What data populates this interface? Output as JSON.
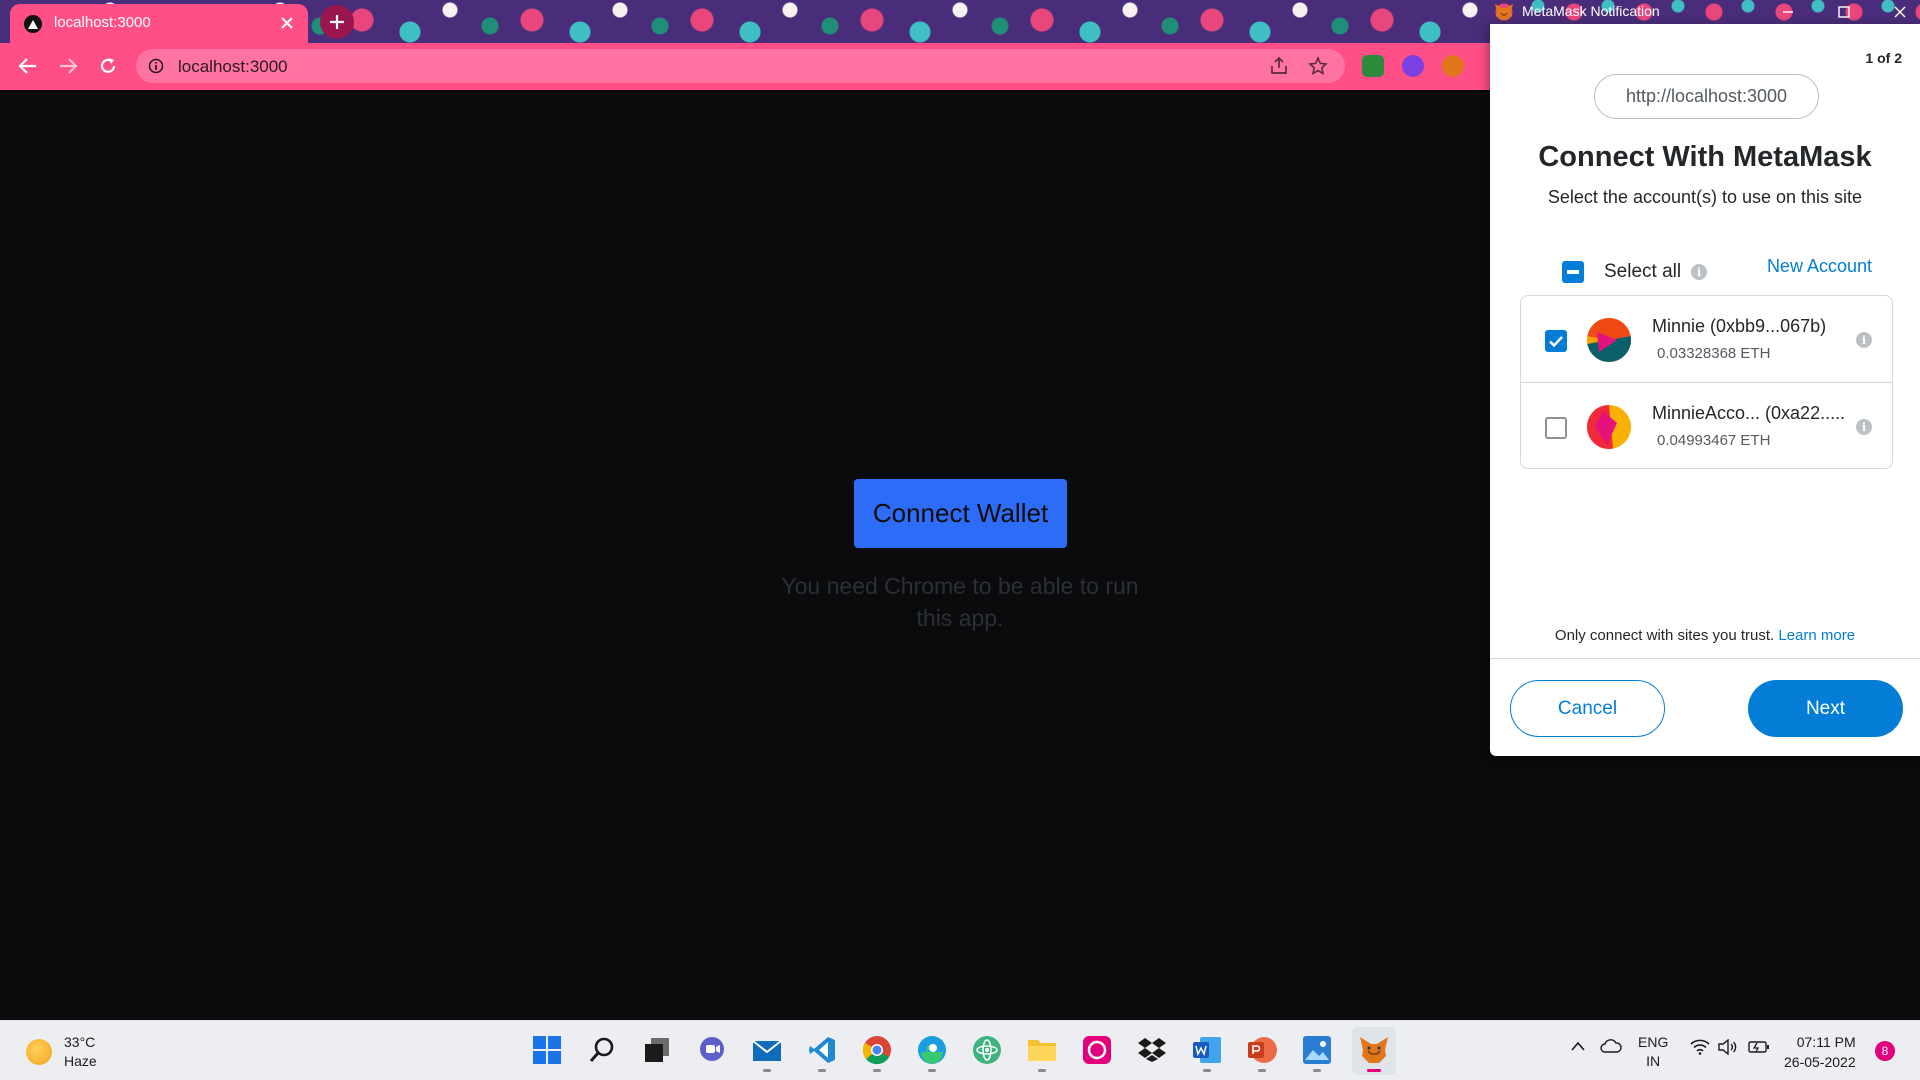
{
  "browser": {
    "tab_title": "localhost:3000",
    "url": "localhost:3000"
  },
  "page": {
    "connect_button_label": "Connect Wallet",
    "chrome_message": "You need Chrome to be able to run this app."
  },
  "metamask": {
    "window_title": "MetaMask Notification",
    "page_count": "1 of 2",
    "origin": "http://localhost:3000",
    "title": "Connect With MetaMask",
    "subtitle": "Select the account(s) to use on this site",
    "select_all_label": "Select all",
    "new_account_label": "New Account",
    "accounts": [
      {
        "name": "Minnie (0xbb9...067b)",
        "balance": "0.03328368 ETH",
        "checked": true
      },
      {
        "name": "MinnieAcco... (0xa22.....",
        "balance": "0.04993467 ETH",
        "checked": false
      }
    ],
    "trust_text": "Only connect with sites you trust.",
    "learn_more_label": "Learn more",
    "cancel_label": "Cancel",
    "next_label": "Next",
    "accent_color": "#037dd6"
  },
  "taskbar": {
    "weather_temp": "33°C",
    "weather_desc": "Haze",
    "lang_line1": "ENG",
    "lang_line2": "IN",
    "time": "07:11 PM",
    "date": "26-05-2022",
    "notification_count": "8",
    "icons": [
      "windows-start-icon",
      "search-icon",
      "task-view-icon",
      "chat-icon",
      "mail-icon",
      "vscode-icon",
      "chrome-icon",
      "edge-icon",
      "atom-icon",
      "file-explorer-icon",
      "app-icon",
      "dropbox-icon",
      "word-icon",
      "powerpoint-icon",
      "photos-icon",
      "metamask-icon"
    ]
  },
  "theme": {
    "browser_pink": "#ff4f86",
    "page_bg": "#0a0b0d",
    "connect_blue": "#2d6cf6"
  }
}
